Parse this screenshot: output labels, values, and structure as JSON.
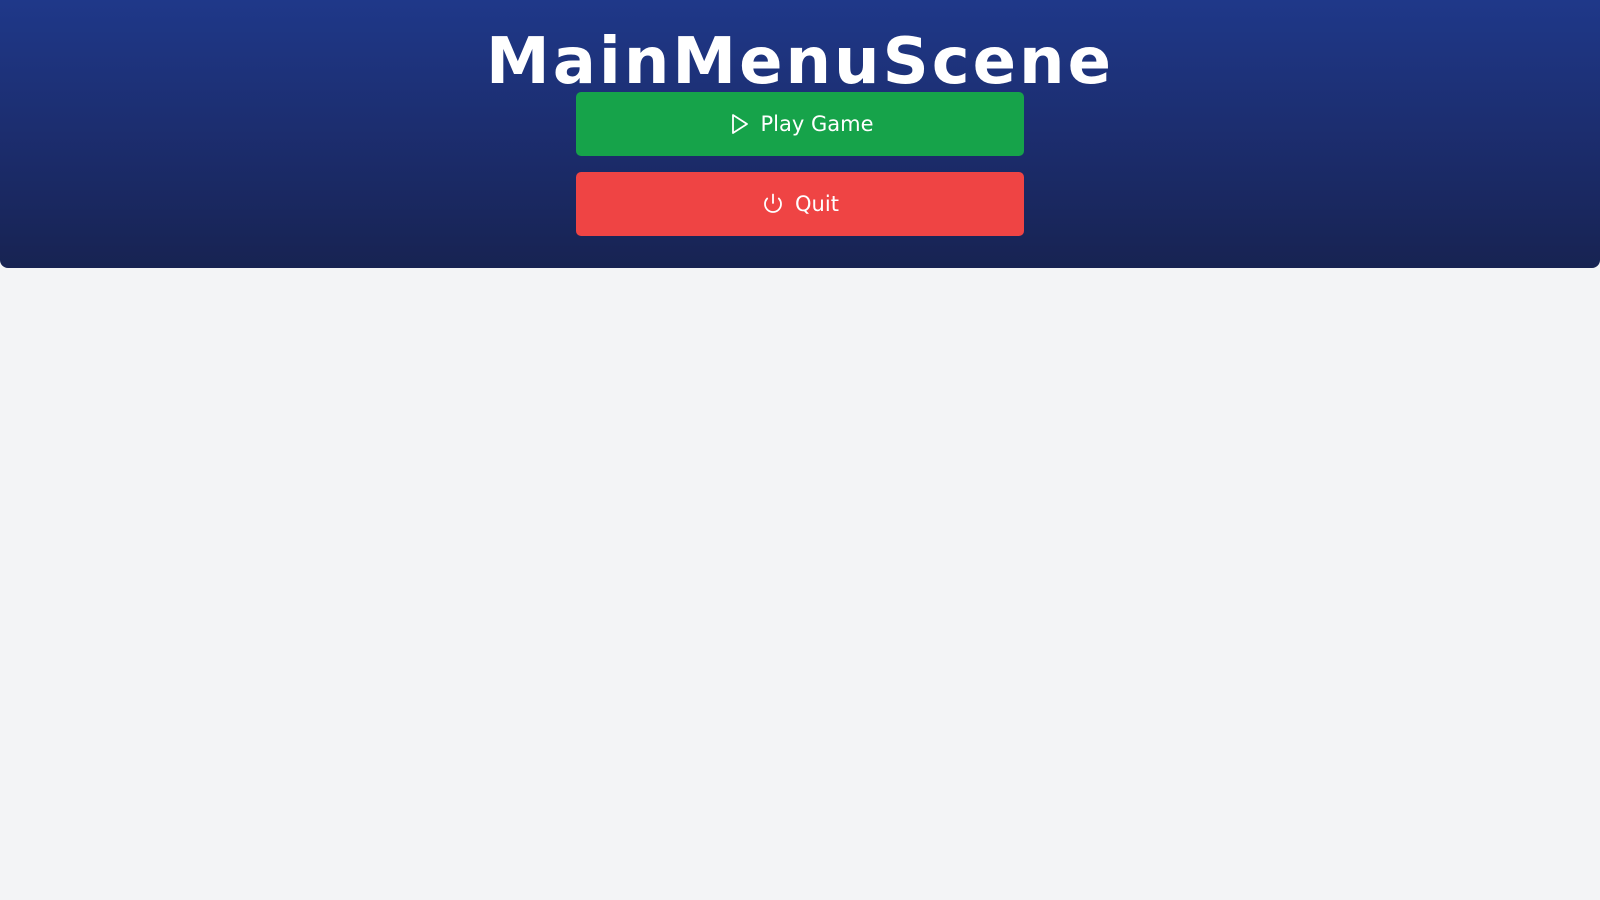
{
  "scene": {
    "title": "MainMenuScene"
  },
  "menu": {
    "play": {
      "label": "Play Game",
      "icon": "play-icon",
      "color": "#16a34a"
    },
    "quit": {
      "label": "Quit",
      "icon": "power-icon",
      "color": "#ef4444"
    }
  },
  "colors": {
    "header_top": "#1f3889",
    "header_bottom": "#172352",
    "background": "#f3f4f6",
    "text": "#ffffff"
  }
}
